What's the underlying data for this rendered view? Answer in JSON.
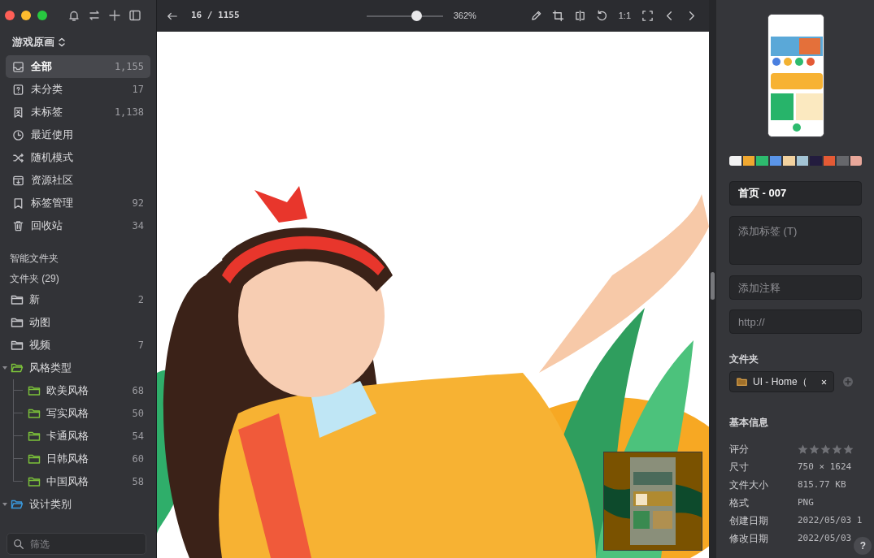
{
  "sidebar": {
    "library": "游戏原画",
    "items": [
      {
        "label": "全部",
        "count": "1,155",
        "selected": true
      },
      {
        "label": "未分类",
        "count": "17",
        "selected": false
      },
      {
        "label": "未标签",
        "count": "1,138",
        "selected": false
      },
      {
        "label": "最近使用",
        "selected": false
      },
      {
        "label": "随机模式",
        "selected": false
      },
      {
        "label": "资源社区",
        "selected": false
      },
      {
        "label": "标签管理",
        "count": "92",
        "selected": false
      },
      {
        "label": "回收站",
        "count": "34",
        "selected": false
      }
    ],
    "smart_folders": "智能文件夹",
    "folders_heading": "文件夹 (29)",
    "folders": [
      {
        "label": "新",
        "count": "2"
      },
      {
        "label": "动图"
      },
      {
        "label": "视频",
        "count": "7"
      },
      {
        "label": "风格类型",
        "color": "#7cc23a",
        "expanded": true,
        "children": [
          {
            "label": "欧美风格",
            "count": "68",
            "color": "#7cc23a"
          },
          {
            "label": "写实风格",
            "count": "50",
            "color": "#7cc23a"
          },
          {
            "label": "卡通风格",
            "count": "54",
            "color": "#7cc23a"
          },
          {
            "label": "日韩风格",
            "count": "60",
            "color": "#7cc23a"
          },
          {
            "label": "中国风格",
            "count": "58",
            "color": "#7cc23a"
          }
        ]
      },
      {
        "label": "设计类别",
        "color": "#3a9be0",
        "expanded": true
      }
    ],
    "filter": {
      "placeholder": "筛选"
    }
  },
  "viewer": {
    "counter": "16 / 1155",
    "zoom": {
      "level": 0.65,
      "reading": "362%"
    },
    "actual_size": "1:1"
  },
  "inspector": {
    "palette": [
      {
        "color": "#f2f2f2"
      },
      {
        "color": "#f0a830"
      },
      {
        "color": "#2dbb6e"
      },
      {
        "color": "#5a95e8"
      },
      {
        "color": "#f2d29f"
      },
      {
        "color": "#a3c4d4"
      },
      {
        "color": "#231c3e"
      },
      {
        "color": "#e45a35"
      },
      {
        "color": "#66676b"
      },
      {
        "color": "#e8a79a"
      }
    ],
    "name": {
      "value": "首页 - 007"
    },
    "tags": {
      "placeholder": "添加标签 (T)"
    },
    "note": {
      "placeholder": "添加注释"
    },
    "url": {
      "placeholder": "http://"
    },
    "folder_heading": "文件夹",
    "folder_chip": "UI - Home（",
    "info_heading": "基本信息",
    "rating": {
      "label": "评分",
      "stars": 0
    },
    "info": [
      {
        "label": "尺寸",
        "value": "750 × 1624"
      },
      {
        "label": "文件大小",
        "value": "815.77 KB"
      },
      {
        "label": "格式",
        "value": "PNG"
      },
      {
        "label": "创建日期",
        "value": "2022/05/03 1"
      },
      {
        "label": "修改日期",
        "value": "2022/05/03"
      }
    ],
    "help": "?"
  }
}
